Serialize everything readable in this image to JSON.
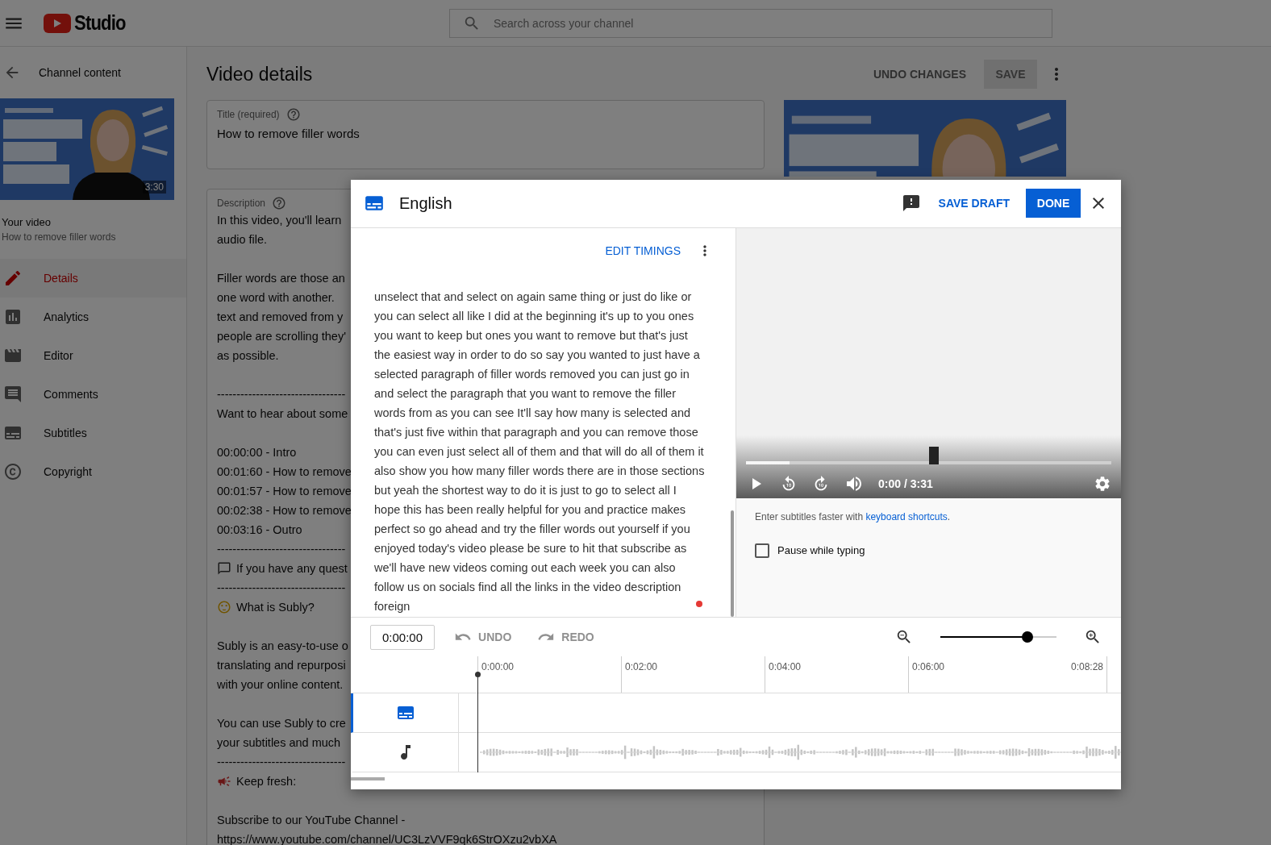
{
  "topbar": {
    "logo": "Studio",
    "search_placeholder": "Search across your channel"
  },
  "sidebar": {
    "back_label": "Channel content",
    "thumbnail": {
      "kind": "picture",
      "duration": "3:30"
    },
    "your_video": "Your video",
    "video_title": "How to remove filler words",
    "items": [
      {
        "label": "Details",
        "kind": "details",
        "selected": true
      },
      {
        "label": "Analytics",
        "kind": "analytics",
        "selected": false
      },
      {
        "label": "Editor",
        "kind": "editor",
        "selected": false
      },
      {
        "label": "Comments",
        "kind": "comments",
        "selected": false
      },
      {
        "label": "Subtitles",
        "kind": "subtitles",
        "selected": false
      },
      {
        "label": "Copyright",
        "kind": "copyright",
        "selected": false
      }
    ]
  },
  "page": {
    "title": "Video details",
    "undo": "UNDO CHANGES",
    "save": {
      "label": "SAVE",
      "disabled": true
    },
    "title_field": {
      "label": "Title (required)",
      "value": "How to remove filler words"
    },
    "description": {
      "label": "Description",
      "lines": [
        {
          "kind": "text",
          "text": "In this video, you'll learn"
        },
        {
          "kind": "text",
          "text": "audio file."
        },
        {
          "kind": "blank"
        },
        {
          "kind": "text",
          "text": "Filler words are those an"
        },
        {
          "kind": "text",
          "text": "one word with another."
        },
        {
          "kind": "text",
          "text": "text and removed from y"
        },
        {
          "kind": "text",
          "text": "people are scrolling they'"
        },
        {
          "kind": "text",
          "text": "as possible."
        },
        {
          "kind": "blank"
        },
        {
          "kind": "text",
          "text": "---------------------------------"
        },
        {
          "kind": "text",
          "text": "Want to hear about some"
        },
        {
          "kind": "blank"
        },
        {
          "kind": "text",
          "text": "00:00:00 - Intro"
        },
        {
          "kind": "text",
          "text": "00:01:60 - How to remove"
        },
        {
          "kind": "text",
          "text": "00:01:57 - How to remove"
        },
        {
          "kind": "text",
          "text": "00:02:38 - How to remove"
        },
        {
          "kind": "text",
          "text": "00:03:16 - Outro"
        },
        {
          "kind": "text",
          "text": "---------------------------------"
        },
        {
          "kind": "chat",
          "text": "If you have any quest"
        },
        {
          "kind": "text",
          "text": "---------------------------------"
        },
        {
          "kind": "smiley",
          "text": "What is Subly?"
        },
        {
          "kind": "blank"
        },
        {
          "kind": "text",
          "text": "Subly is an easy-to-use o"
        },
        {
          "kind": "text",
          "text": "translating and repurposi"
        },
        {
          "kind": "text",
          "text": "with your online content."
        },
        {
          "kind": "blank"
        },
        {
          "kind": "text",
          "text": "You can use Subly to cre"
        },
        {
          "kind": "text",
          "text": "your subtitles and much"
        },
        {
          "kind": "text",
          "text": "---------------------------------"
        },
        {
          "kind": "megaphone",
          "text": "Keep fresh:"
        },
        {
          "kind": "blank"
        },
        {
          "kind": "text",
          "text": "Subscribe to our YouTube Channel -"
        },
        {
          "kind": "text",
          "text": "https://www.youtube.com/channel/UC3LzVVF9qk6StrOXzu2vbXA"
        }
      ]
    }
  },
  "dialog": {
    "title": "English",
    "save_draft": "SAVE DRAFT",
    "done": "DONE",
    "edit_timings": "EDIT TIMINGS",
    "transcript": "unselect that and select on again same thing or just do like or you can select all like I did at the beginning it's up to you ones you want to keep but ones you want to remove but that's just the easiest way in order to do so say you wanted to just have a selected paragraph of filler words removed you can just go in and select the paragraph that you want to remove the filler words from as you can see It'll say how many is selected and that's just five within that paragraph and you can remove those you can even just select all of them and that will do all of them it also show you how many filler words there are in those sections but yeah the shortest way to do it is just to go to select all I hope this has been really helpful for you and practice makes perfect so go ahead and try the filler words out yourself if you enjoyed today's video please be sure to hit that subscribe as we'll have new videos coming out each week you can also follow us on socials find all the links in the video description foreign",
    "player": {
      "level": 0.12,
      "time": "0:00 / 3:31"
    },
    "hint": {
      "text": "Enter subtitles faster with",
      "link": "keyboard shortcuts",
      "end": "."
    },
    "pause": {
      "label": "Pause while typing",
      "checked": false
    },
    "toolbar": {
      "timecode": "0:00:00",
      "undo": "UNDO",
      "redo": "REDO",
      "zoom": {
        "level": 0.75
      }
    },
    "ruler": [
      "0:00:00",
      "0:02:00",
      "0:04:00",
      "0:06:00",
      "0:08:28"
    ],
    "tracks": [
      {
        "kind": "subtitles",
        "selected": true
      },
      {
        "kind": "audio",
        "selected": false
      }
    ]
  }
}
